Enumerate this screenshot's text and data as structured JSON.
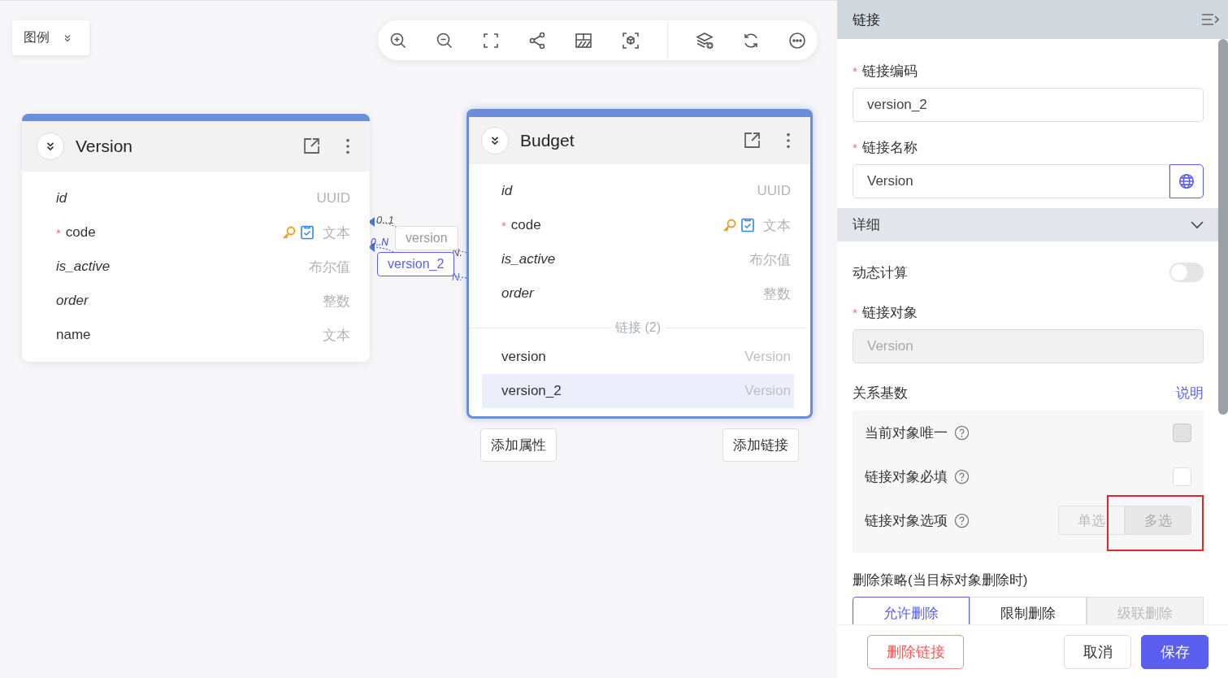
{
  "legend": {
    "label": "图例"
  },
  "toolbar": [
    {
      "kind": "zoom-in"
    },
    {
      "kind": "zoom-out"
    },
    {
      "kind": "fit"
    },
    {
      "kind": "share"
    },
    {
      "kind": "grid"
    },
    {
      "kind": "focus"
    },
    {
      "kind": "layers",
      "separated": true
    },
    {
      "kind": "refresh"
    },
    {
      "kind": "more"
    }
  ],
  "entities": [
    {
      "name": "Version",
      "selected": false,
      "fields": [
        {
          "name": "id",
          "italic": true,
          "type": "UUID"
        },
        {
          "name": "code",
          "italic": false,
          "marker": "*",
          "key": true,
          "unique": true,
          "type": "文本"
        },
        {
          "name": "is_active",
          "italic": true,
          "type": "布尔值"
        },
        {
          "name": "order",
          "italic": true,
          "type": "整数"
        },
        {
          "name": "name",
          "italic": false,
          "type": "文本"
        }
      ]
    },
    {
      "name": "Budget",
      "selected": true,
      "fields": [
        {
          "name": "id",
          "italic": true,
          "type": "UUID"
        },
        {
          "name": "code",
          "italic": false,
          "marker": "*",
          "key": true,
          "unique": true,
          "type": "文本"
        },
        {
          "name": "is_active",
          "italic": true,
          "type": "布尔值"
        },
        {
          "name": "order",
          "italic": true,
          "type": "整数"
        }
      ],
      "links_heading": "链接 (2)",
      "links": [
        {
          "name": "version",
          "target": "Version",
          "selected": false
        },
        {
          "name": "version_2",
          "target": "Version",
          "selected": true
        }
      ],
      "buttons": [
        "添加属性",
        "添加链接"
      ]
    }
  ],
  "edges": [
    {
      "label": "version",
      "selected": false,
      "from_card": "0..1",
      "to_card": "N."
    },
    {
      "label": "version_2",
      "selected": true,
      "from_card": "0..N",
      "to_card": "N."
    }
  ],
  "panel": {
    "title": "链接",
    "code": {
      "label": "链接编码",
      "marker": "*",
      "value": "version_2"
    },
    "name": {
      "label": "链接名称",
      "marker": "*",
      "value": "Version"
    },
    "section": {
      "label": "详细",
      "expanded": true
    },
    "dynamic": {
      "label": "动态计算",
      "on": false
    },
    "target": {
      "label": "链接对象",
      "marker": "*",
      "value": "Version",
      "disabled": true
    },
    "cardinality": {
      "label": "关系基数",
      "help_link": "说明",
      "rows": [
        {
          "kind": "checkbox",
          "label": "当前对象唯一",
          "checked": false,
          "disabled": true
        },
        {
          "kind": "checkbox",
          "label": "链接对象必填",
          "checked": false,
          "disabled": false
        },
        {
          "kind": "segmented",
          "label": "链接对象选项",
          "options": [
            {
              "label": "单选",
              "selected": false,
              "highlighted": false
            },
            {
              "label": "多选",
              "selected": true,
              "highlighted": true
            }
          ]
        }
      ]
    },
    "delete_policy": {
      "label": "删除策略(当目标对象删除时)",
      "options": [
        {
          "label": "允许删除",
          "selected": true,
          "disabled": false
        },
        {
          "label": "限制删除",
          "selected": false,
          "disabled": false
        },
        {
          "label": "级联删除",
          "selected": false,
          "disabled": true
        }
      ]
    },
    "buttons": [
      {
        "label": "删除链接",
        "kind": "danger"
      },
      {
        "label": "取消",
        "kind": "default"
      },
      {
        "label": "保存",
        "kind": "primary"
      }
    ]
  }
}
